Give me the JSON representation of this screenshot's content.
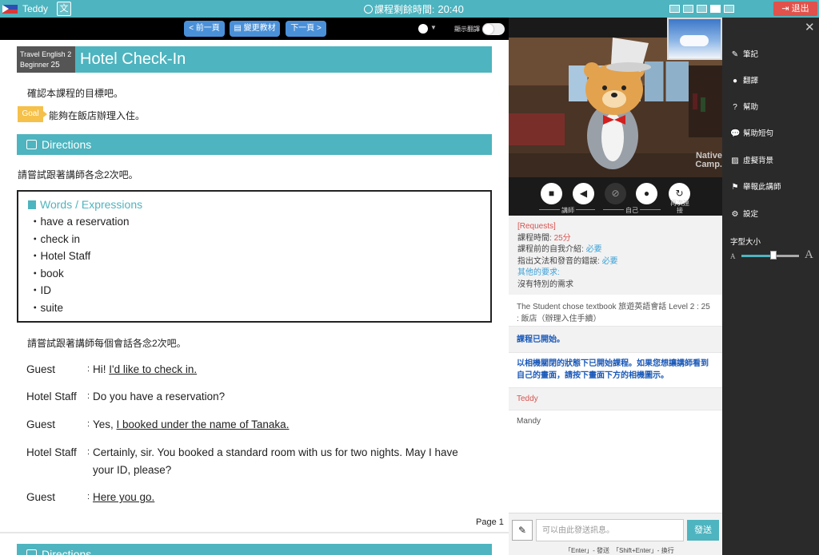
{
  "topbar": {
    "teacher_name": "Teddy",
    "translate_icon": "文A",
    "timer_label": "課程剩餘時間:",
    "timer_value": "20:40",
    "exit_label": "退出"
  },
  "navbar": {
    "prev_label": "< 前一頁",
    "change_label": "變更教材",
    "next_label": "下一頁 >",
    "show_translation_label": "顯示翻譯",
    "show_translation_on": false
  },
  "lesson": {
    "course": "Travel English 2",
    "level_label": "Beginner",
    "level_number": "25",
    "title": "Hotel Check-In",
    "intro": "確認本課程的目標吧。",
    "goal_badge": "Goal",
    "goal_text": "能夠在飯店辦理入住。",
    "directions_label": "Directions",
    "instruction_1": "請嘗試跟著講師各念2次吧。",
    "words_title": "Words / Expressions",
    "words": [
      "・have a reservation",
      "・check in",
      "・Hotel Staff",
      "・book",
      "・ID",
      "・suite"
    ],
    "instruction_2": "請嘗試跟著講師每個會話各念2次吧。",
    "dialog": [
      {
        "speaker": "Guest",
        "plain": "Hi! ",
        "underlined": "I'd like to check in.",
        "rest": ""
      },
      {
        "speaker": "Hotel Staff",
        "plain": "Do you have a reservation?",
        "underlined": "",
        "rest": ""
      },
      {
        "speaker": "Guest",
        "plain": "Yes, ",
        "underlined": "I booked under the name of Tanaka.",
        "rest": ""
      },
      {
        "speaker": "Hotel Staff",
        "plain": "Certainly, sir. You booked a standard room with us for two nights. May I have your ID, please?",
        "underlined": "",
        "rest": ""
      },
      {
        "speaker": "Guest",
        "plain": "",
        "underlined": "Here you go.",
        "rest": ""
      }
    ],
    "page_label": "Page 1",
    "next_directions_label": "Directions"
  },
  "video": {
    "brand": "Native Camp.",
    "teacher_label": "講師",
    "self_label": "自己",
    "reconnect_label": "再次連接"
  },
  "chat": {
    "requests_title": "[Requests]",
    "lesson_time_label": "課程時間: ",
    "lesson_time_value": "25分",
    "self_intro_label": "課程前的自我介紹: ",
    "self_intro_value": "必要",
    "correction_label": "指出文法和發音的錯誤: ",
    "correction_value": "必要",
    "other_requests_label": "其他的要求:",
    "other_requests_value": "沒有特別的需求",
    "textbook_msg": "The Student chose textbook 旅遊英語會話 Level 2 : 25 : 飯店（辦理入住手續）",
    "started_msg": "課程已開始。",
    "camera_msg": "以相機關閉的狀態下已開始課程。如果您想讓講師看到自己的畫面，請按下畫面下方的相機圖示。",
    "sender_teacher": "Teddy",
    "sender_student": "Mandy",
    "input_placeholder": "可以由此發送訊息。",
    "send_label": "發送",
    "hint": "「Enter」- 發送　「Shift+Enter」- 換行"
  },
  "panel": {
    "items": [
      "筆記",
      "翻譯",
      "幫助",
      "幫助短句",
      "虛擬背景",
      "舉報此講師",
      "設定"
    ],
    "font_size_label": "字型大小",
    "font_small": "A",
    "font_big": "A",
    "font_size_level": 0.55
  },
  "colors": {
    "accent": "#4eb4bf",
    "exit": "#e0524b",
    "nav_button": "#4a90d9",
    "goal": "#f5c14b"
  }
}
